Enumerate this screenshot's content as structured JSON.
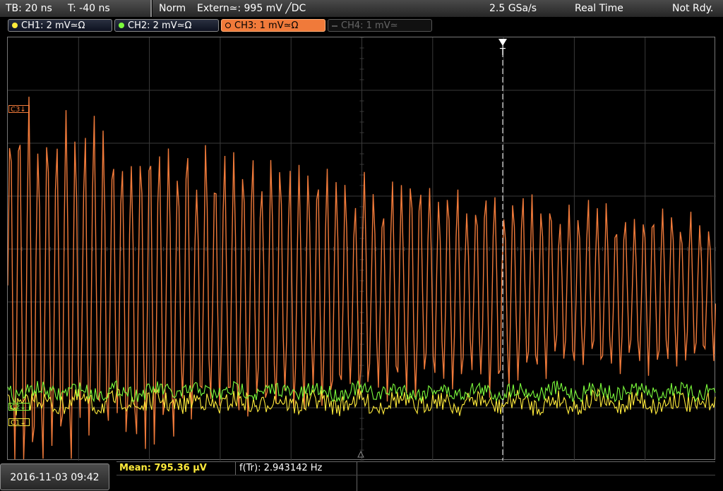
{
  "status_bar": {
    "timebase": "TB: 20 ns",
    "trigger_offset": "T: -40 ns",
    "mode": "Norm",
    "trigger_source": "Extern≃: 995 mV ╱DC",
    "sample_rate": "2.5 GSa/s",
    "acquisition": "Real Time",
    "ready_state": "Not Rdy."
  },
  "channels": [
    {
      "label": "CH1: 2 mV≃Ω",
      "color": "#ffeb3b",
      "state": "on"
    },
    {
      "label": "CH2: 2 mV≃Ω",
      "color": "#7cfc3c",
      "state": "on"
    },
    {
      "label": "CH3: 1 mV≃Ω",
      "color": "#f07a3a",
      "state": "active"
    },
    {
      "label": "CH4: 1 mV≃",
      "color": "#666666",
      "state": "off"
    }
  ],
  "markers": {
    "c3": "C3↓",
    "c1": "C1↓",
    "c2": "C2↓",
    "trigger": "T"
  },
  "footer": {
    "datetime": "2016-11-03 09:42",
    "mean_label": "Mean: 795.36 µV",
    "freq_label": "f(Tr): 2.943142 Hz"
  },
  "colors": {
    "grid": "#3a3a3a",
    "ch1": "#ffeb3b",
    "ch2": "#7cfc3c",
    "ch3": "#f07a3a"
  }
}
